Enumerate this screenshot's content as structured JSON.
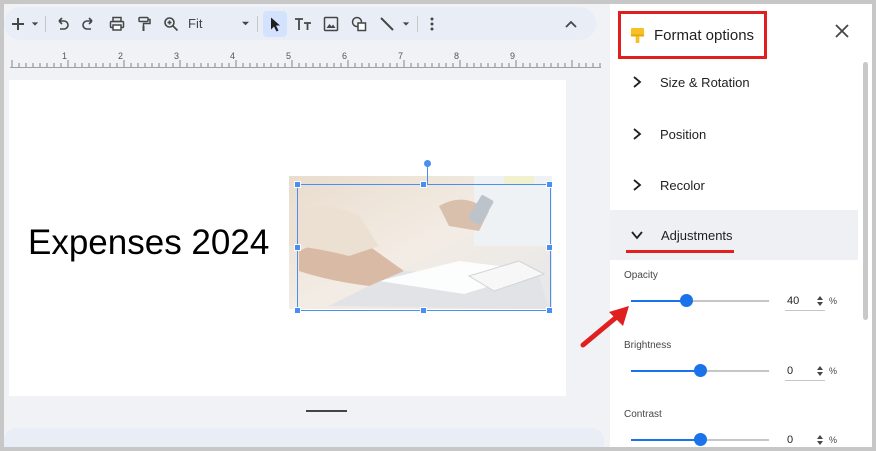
{
  "toolbar": {
    "zoom_label": "Fit",
    "items": [
      "add-icon",
      "undo-icon",
      "redo-icon",
      "print-icon",
      "paint-format-icon",
      "zoom-icon",
      "select-icon",
      "text-box-icon",
      "image-icon",
      "shape-icon",
      "line-icon",
      "more-icon",
      "collapse-icon"
    ]
  },
  "ruler": {
    "marks": [
      "1",
      "2",
      "3",
      "4",
      "5",
      "6",
      "7",
      "8",
      "9"
    ]
  },
  "slide": {
    "title": "Expenses 2024"
  },
  "panel": {
    "title": "Format options",
    "sections": [
      {
        "label": "Size & Rotation",
        "expanded": false
      },
      {
        "label": "Position",
        "expanded": false
      },
      {
        "label": "Recolor",
        "expanded": false
      },
      {
        "label": "Adjustments",
        "expanded": true
      }
    ],
    "adjustments": {
      "opacity": {
        "label": "Opacity",
        "value": "40",
        "unit": "%",
        "fraction": 0.4
      },
      "brightness": {
        "label": "Brightness",
        "value": "0",
        "unit": "%",
        "fraction": 0.5
      },
      "contrast": {
        "label": "Contrast",
        "value": "0",
        "unit": "%",
        "fraction": 0.5
      }
    }
  },
  "colors": {
    "accent": "#1a73e8",
    "highlight_red": "#e0201f",
    "selection": "#4a8ef0"
  }
}
